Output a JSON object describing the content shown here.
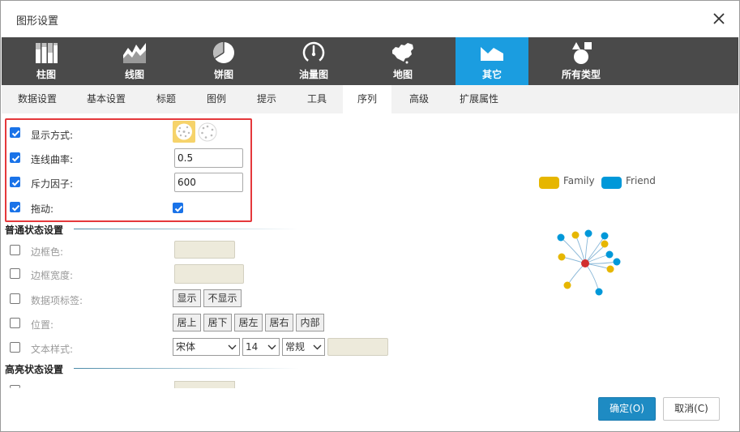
{
  "dialog": {
    "title": "图形设置"
  },
  "chart_types": [
    {
      "label": "柱图",
      "icon": "bar-chart-icon"
    },
    {
      "label": "线图",
      "icon": "line-chart-icon"
    },
    {
      "label": "饼图",
      "icon": "pie-chart-icon"
    },
    {
      "label": "油量图",
      "icon": "gauge-icon"
    },
    {
      "label": "地图",
      "icon": "map-icon"
    },
    {
      "label": "其它",
      "icon": "other-chart-icon",
      "active": true
    },
    {
      "label": "所有类型",
      "icon": "all-types-icon"
    }
  ],
  "tabs": [
    {
      "label": "数据设置"
    },
    {
      "label": "基本设置"
    },
    {
      "label": "标题"
    },
    {
      "label": "图例"
    },
    {
      "label": "提示"
    },
    {
      "label": "工具"
    },
    {
      "label": "序列",
      "active": true
    },
    {
      "label": "高级"
    },
    {
      "label": "扩展属性"
    }
  ],
  "series": {
    "display_mode": {
      "label": "显示方式:",
      "checked": true,
      "options": [
        "force-layout-icon",
        "circular-layout-icon"
      ],
      "selected": 0
    },
    "curveness": {
      "label": "连线曲率:",
      "checked": true,
      "value": "0.5"
    },
    "repulsion": {
      "label": "斥力因子:",
      "checked": true,
      "value": "600"
    },
    "draggable": {
      "label": "拖动:",
      "checked": true,
      "value_checked": true
    }
  },
  "normal_state": {
    "section_title": "普通状态设置",
    "border_color": {
      "label": "边框色:",
      "checked": false
    },
    "border_width": {
      "label": "边框宽度:",
      "checked": false
    },
    "data_label": {
      "label": "数据项标签:",
      "checked": false,
      "buttons": [
        "显示",
        "不显示"
      ]
    },
    "position": {
      "label": "位置:",
      "checked": false,
      "buttons": [
        "居上",
        "居下",
        "居左",
        "居右",
        "内部"
      ]
    },
    "text_style": {
      "label": "文本样式:",
      "checked": false,
      "font": "宋体",
      "size": "14",
      "weight": "常规"
    }
  },
  "highlight_state": {
    "section_title": "高亮状态设置"
  },
  "preview": {
    "legend": [
      {
        "name": "Family",
        "color": "#e6b600"
      },
      {
        "name": "Friend",
        "color": "#0098d9"
      }
    ],
    "center_color": "#d12e2e"
  },
  "footer": {
    "ok": "确定(O)",
    "cancel": "取消(C)"
  }
}
